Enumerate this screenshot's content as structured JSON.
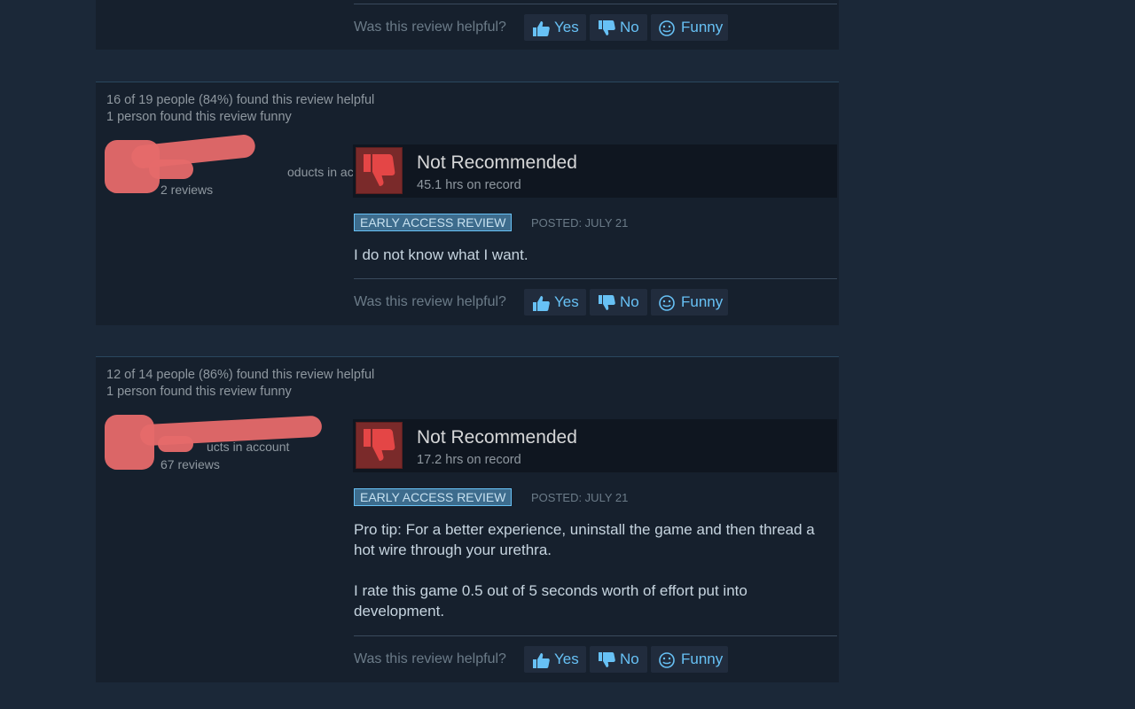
{
  "reviews": [
    {
      "helpful_line": "",
      "funny_line": "",
      "author": {
        "products": "",
        "reviews": ""
      },
      "verdict": "",
      "hours": "",
      "badge": "",
      "posted": "",
      "paragraphs": []
    },
    {
      "helpful_line": "16 of 19 people (84%) found this review helpful",
      "funny_line": "1 person found this review funny",
      "author": {
        "products": "oducts in account",
        "reviews": "2 reviews"
      },
      "verdict": "Not Recommended",
      "hours": "45.1 hrs on record",
      "badge": "EARLY ACCESS REVIEW",
      "posted": "POSTED: JULY 21",
      "paragraphs": [
        "I do not know what I want."
      ]
    },
    {
      "helpful_line": "12 of 14 people (86%) found this review helpful",
      "funny_line": "1 person found this review funny",
      "author": {
        "products": "ucts in account",
        "reviews": "67 reviews"
      },
      "verdict": "Not Recommended",
      "hours": "17.2 hrs on record",
      "badge": "EARLY ACCESS REVIEW",
      "posted": "POSTED: JULY 21",
      "paragraphs": [
        "Pro tip: For a better experience, uninstall the game and then thread a hot wire through your urethra.",
        "I rate this game 0.5 out of 5 seconds worth of effort put into development."
      ]
    }
  ],
  "voting": {
    "question": "Was this review helpful?",
    "yes": "Yes",
    "no": "No",
    "funny": "Funny"
  },
  "icons": {
    "yes": "thumbs-up-icon",
    "no": "thumbs-down-icon",
    "funny": "smiley-icon",
    "verdict": "thumbs-down-icon"
  },
  "colors": {
    "background": "#1b2838",
    "card": "#16202d",
    "link": "#67c1f5",
    "negative": "#7a2a2a",
    "redaction": "#e66a6a"
  }
}
